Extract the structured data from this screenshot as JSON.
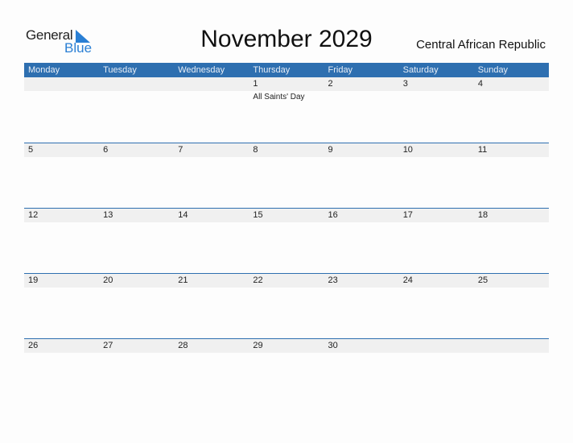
{
  "logo": {
    "word1": "General",
    "word2": "Blue"
  },
  "title": "November 2029",
  "country": "Central African Republic",
  "colors": {
    "header": "#2e6fb0",
    "strip": "#f0f0f0",
    "logo_blue": "#2a7fd4"
  },
  "weekdays": [
    "Monday",
    "Tuesday",
    "Wednesday",
    "Thursday",
    "Friday",
    "Saturday",
    "Sunday"
  ],
  "weeks": [
    {
      "days": [
        "",
        "",
        "",
        "1",
        "2",
        "3",
        "4"
      ],
      "holidays": [
        "",
        "",
        "",
        "All Saints' Day",
        "",
        "",
        ""
      ]
    },
    {
      "days": [
        "5",
        "6",
        "7",
        "8",
        "9",
        "10",
        "11"
      ],
      "holidays": [
        "",
        "",
        "",
        "",
        "",
        "",
        ""
      ]
    },
    {
      "days": [
        "12",
        "13",
        "14",
        "15",
        "16",
        "17",
        "18"
      ],
      "holidays": [
        "",
        "",
        "",
        "",
        "",
        "",
        ""
      ]
    },
    {
      "days": [
        "19",
        "20",
        "21",
        "22",
        "23",
        "24",
        "25"
      ],
      "holidays": [
        "",
        "",
        "",
        "",
        "",
        "",
        ""
      ]
    },
    {
      "days": [
        "26",
        "27",
        "28",
        "29",
        "30",
        "",
        ""
      ],
      "holidays": [
        "",
        "",
        "",
        "",
        "",
        "",
        ""
      ]
    }
  ]
}
